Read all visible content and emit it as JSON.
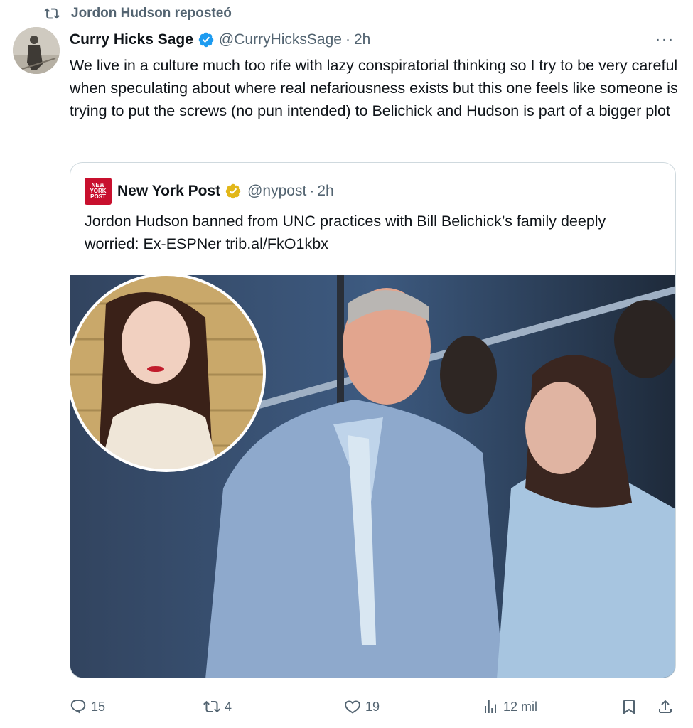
{
  "repost": {
    "label": "Jordon Hudson reposteó",
    "icon": "repost-icon"
  },
  "tweet": {
    "author_name": "Curry Hicks Sage",
    "author_handle": "@CurryHicksSage",
    "separator": "·",
    "time": "2h",
    "more": "···",
    "text": "We live in a culture much too rife with lazy conspiratorial thinking so I try to be very careful when speculating about where real nefariousness exists but this one feels like someone is trying to put the screws (no pun intended) to Belichick and Hudson is part of a bigger plot"
  },
  "quote": {
    "logo_lines": [
      "NEW",
      "YORK",
      "POST"
    ],
    "author_name": "New York Post",
    "author_handle": "@nypost",
    "separator": "·",
    "time": "2h",
    "text": "Jordon Hudson banned from UNC practices with Bill Belichick’s family deeply worried: Ex-ESPNer trib.al/FkO1kbx",
    "image_icon": "photo"
  },
  "actions": {
    "reply_count": "15",
    "repost_count": "4",
    "like_count": "19",
    "views_count": "12 mil"
  },
  "colors": {
    "text": "#0f1419",
    "secondary": "#536471",
    "verified_blue": "#1d9bf0",
    "verified_gold": "#e2b719",
    "nypost_red": "#c8102e",
    "border": "#cfd9de"
  }
}
